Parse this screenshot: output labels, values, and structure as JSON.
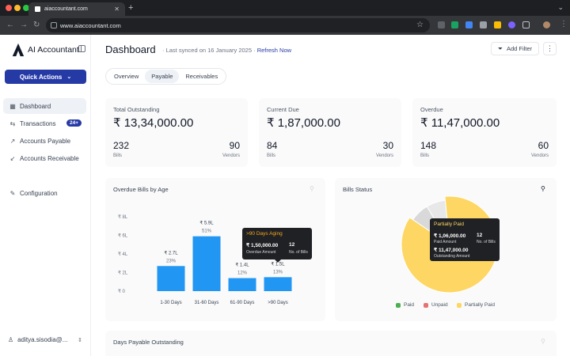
{
  "browser": {
    "tab_title": "aiaccountant.com",
    "url": "www.aiaccountant.com"
  },
  "sidebar": {
    "brand": "AI Accountant",
    "quick_actions": "Quick Actions",
    "items": [
      {
        "label": "Dashboard",
        "icon": "grid-icon"
      },
      {
        "label": "Transactions",
        "icon": "arrows-icon",
        "badge": "24+"
      },
      {
        "label": "Accounts Payable",
        "icon": "arrow-up-right-icon"
      },
      {
        "label": "Accounts Receivable",
        "icon": "arrow-down-left-icon"
      },
      {
        "label": "Configuration",
        "icon": "wrench-icon"
      }
    ],
    "user": "aditya.sisodia@..."
  },
  "header": {
    "title": "Dashboard",
    "sync_text": "Last synced on 16 January 2025",
    "refresh": "Refresh Now",
    "add_filter": "Add Filter",
    "more": "⋮"
  },
  "tabs": [
    "Overview",
    "Payable",
    "Receivables"
  ],
  "stats": [
    {
      "label": "Total Outstanding",
      "value": "₹ 13,34,000.00",
      "left_num": "232",
      "left_sub": "Bills",
      "right_num": "90",
      "right_sub": "Vendors"
    },
    {
      "label": "Current Due",
      "value": "₹ 1,87,000.00",
      "left_num": "84",
      "left_sub": "Bills",
      "right_num": "30",
      "right_sub": "Vendors"
    },
    {
      "label": "Overdue",
      "value": "₹ 11,47,000.00",
      "left_num": "148",
      "left_sub": "Bills",
      "right_num": "60",
      "right_sub": "Vendors"
    }
  ],
  "overdue_chart": {
    "title": "Overdue Bills by Age",
    "tooltip": {
      "title": ">90 Days Aging",
      "amount": "₹ 1,50,000.00",
      "amount_label": "Overdue Amount",
      "count": "12",
      "count_label": "No. of Bills"
    }
  },
  "bills_status": {
    "title": "Bills Status",
    "tooltip": {
      "title": "Partially Paid",
      "amount": "₹ 1,06,000.00",
      "amount_label": "Paid Amount",
      "count": "12",
      "count_label": "No. of Bills",
      "outstanding": "₹ 11,47,000.00",
      "outstanding_label": "Outstanding Amount"
    },
    "legend": [
      {
        "label": "Paid",
        "color": "#4caf50"
      },
      {
        "label": "Unpaid",
        "color": "#e57373"
      },
      {
        "label": "Partially Paid",
        "color": "#fdd663"
      }
    ]
  },
  "dpo": {
    "title": "Days Payable Outstanding"
  },
  "chart_data": [
    {
      "type": "bar",
      "title": "Overdue Bills by Age",
      "categories": [
        "1-30 Days",
        "31-60 Days",
        "61-90 Days",
        ">90 Days"
      ],
      "values": [
        2.7,
        5.9,
        1.4,
        1.5
      ],
      "value_labels": [
        "₹ 2.7L",
        "₹ 5.9L",
        "₹ 1.4L",
        "₹ 1.5L"
      ],
      "percent_labels": [
        "23%",
        "51%",
        "12%",
        "13%"
      ],
      "yticks": [
        "₹ 0",
        "₹ 2L",
        "₹ 4L",
        "₹ 6L",
        "₹ 8L"
      ],
      "ylim": [
        0,
        8
      ],
      "color": "#2196f3"
    },
    {
      "type": "pie",
      "title": "Bills Status",
      "labels": [
        "Paid",
        "Unpaid",
        "Partially Paid"
      ],
      "values": [
        7,
        7,
        86
      ],
      "colors": [
        "#d9d9d9",
        "#e8e8e8",
        "#fdd663"
      ]
    }
  ]
}
